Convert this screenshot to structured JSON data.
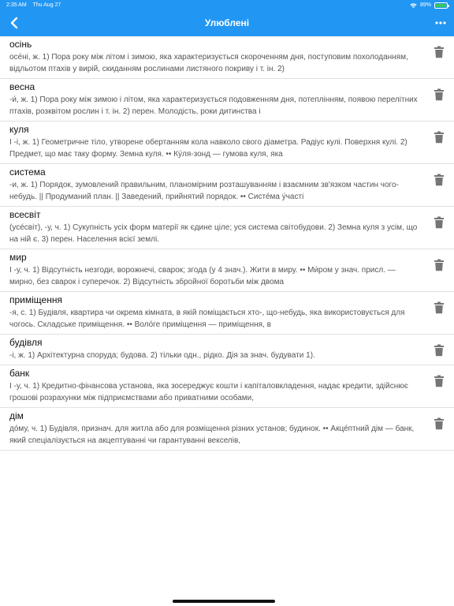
{
  "status_bar": {
    "time": "2:35 AM",
    "date": "Thu Aug 27",
    "battery": "89%"
  },
  "header": {
    "title": "Улюблені",
    "back_icon": "chevron-left-icon",
    "more_icon": "ellipsis-icon",
    "color": "#2196f3"
  },
  "words": [
    {
      "title": "осінь",
      "definition": "осе́ні, ж. 1) Пора року між літом і зимою, яка характеризується скороченням дня, поступовим похолоданням, відльотом птахів у вирій, скиданням рослинами листяного покриву і т. ін. 2)"
    },
    {
      "title": "весна",
      "definition": "-и́, ж. 1) Пора року між зимою і літом, яка характеризується подовженням дня, потеплінням, появою перелітних птахів, розквітом рослин і т. ін. 2) перен. Молодість, роки дитинства і"
    },
    {
      "title": "куля",
      "definition": "I -і, ж. 1) Геометричне тіло, утворене обертанням кола навколо свого діаметра. Радіус кулі. Поверхня кулі. 2) Предмет, що має таку форму. Земна куля. •• Ку́ля-зонд — гумова куля, яка"
    },
    {
      "title": "система",
      "definition": "-и, ж. 1) Порядок, зумовлений правильним, планомірним розташуванням і взаємним зв'язком частин чого-небудь. || Продуманий план. || Заведений, прийнятий порядок. •• Систе́ма у́часті"
    },
    {
      "title": "всесвіт",
      "definition": "(усе́світ), -у, ч. 1) Сукупність усіх форм матерії як єдине ціле; уся система світобудови. 2) Земна куля з усім, що на ній є. 3) перен. Населення всієї землі."
    },
    {
      "title": "мир",
      "definition": "I -у, ч. 1) Відсутність незгоди, ворожнечі, сварок; згода (у 4 знач.). Жити в миру. •• Ми́ром у знач. присл. — мирно, без сварок і суперечок. 2) Відсутність збройної боротьби між двома"
    },
    {
      "title": "приміщення",
      "definition": "-я, с. 1) Будівля, квартира чи окрема кімната, в якій поміщається хто-, що-небудь, яка використовується для чогось. Складське приміщення. •• Воло́ге приміщення — приміщення, в"
    },
    {
      "title": "будівля",
      "definition": "-і, ж. 1) Архітектурна споруда; будова. 2) тільки одн., рідко. Дія за знач. будувати 1)."
    },
    {
      "title": "банк",
      "definition": "I -у, ч. 1) Кредитно-фінансова установа, яка зосереджує кошти і капіталовкладення, надає кредити, здійснює грошові розрахунки між підприємствами або приватними особами,"
    },
    {
      "title": "дім",
      "definition": "до́му, ч. 1) Будівля, признач. для житла або для розміщення різних установ; будинок. •• Акце́птний дім — банк, який спеціалізується на акцептуванні чи гарантуванні векселів,"
    }
  ]
}
